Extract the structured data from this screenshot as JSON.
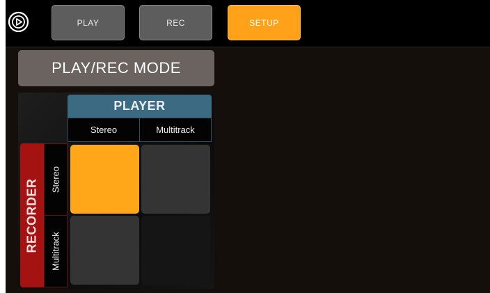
{
  "topbar": {
    "logo_icon": "play-circle-icon",
    "tabs": [
      {
        "label": "PLAY",
        "state": "inactive"
      },
      {
        "label": "REC",
        "state": "inactive"
      },
      {
        "label": "SETUP",
        "state": "active"
      }
    ]
  },
  "main": {
    "title": "PLAY/REC MODE",
    "matrix": {
      "player_header": "PLAYER",
      "recorder_header": "RECORDER",
      "columns": [
        "Stereo",
        "Multitrack"
      ],
      "rows": [
        "Stereo",
        "Multitrack"
      ],
      "selected": {
        "player": "Stereo",
        "recorder": "Stereo"
      }
    }
  },
  "colors": {
    "accent_orange": "#ffa219",
    "player_blue": "#3b6a82",
    "recorder_red": "#a51212",
    "tab_grey": "#5d5d5d",
    "title_grey": "#6b6360"
  }
}
